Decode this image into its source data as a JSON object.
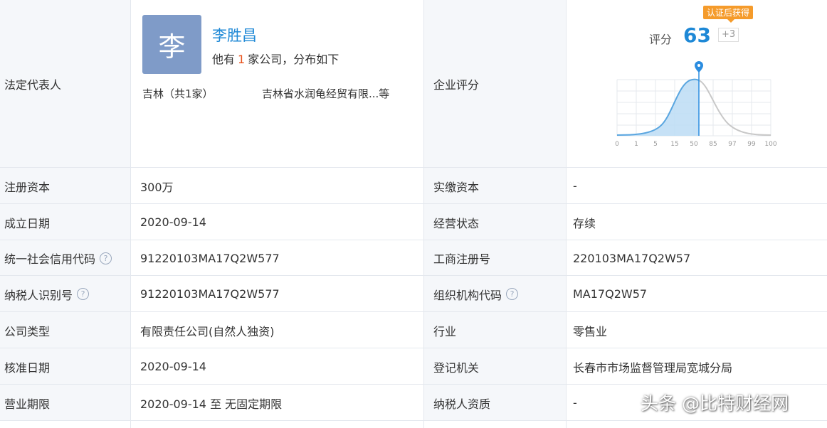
{
  "legal_rep": {
    "label": "法定代表人",
    "avatar_char": "李",
    "name": "李胜昌",
    "sub_prefix": "他有",
    "company_count": "1",
    "sub_suffix": "家公司，分布如下",
    "region": "吉林（共1家）",
    "company": "吉林省水润龟经贸有限...等"
  },
  "rating": {
    "label": "企业评分",
    "badge": "认证后获得",
    "score_label": "评分",
    "score": 63,
    "delta": "+3",
    "axis_ticks": [
      "0",
      "1",
      "5",
      "15",
      "50",
      "85",
      "97",
      "99",
      "100"
    ],
    "colors": {
      "accent": "#1e88d6",
      "curve_fill": "#bcdcf5",
      "marker": "#2b8de0",
      "badge": "#f59b2b",
      "count": "#e8541e"
    }
  },
  "rows": [
    {
      "left_label": "注册资本",
      "left_value": "300万",
      "right_label": "实缴资本",
      "right_value": "-"
    },
    {
      "left_label": "成立日期",
      "left_value": "2020-09-14",
      "right_label": "经营状态",
      "right_value": "存续"
    },
    {
      "left_label": "统一社会信用代码",
      "left_help": true,
      "left_value": "91220103MA17Q2W577",
      "right_label": "工商注册号",
      "right_value": "220103MA17Q2W57"
    },
    {
      "left_label": "纳税人识别号",
      "left_help": true,
      "left_value": "91220103MA17Q2W577",
      "right_label": "组织机构代码",
      "right_help": true,
      "right_value": "MA17Q2W57"
    },
    {
      "left_label": "公司类型",
      "left_value": "有限责任公司(自然人独资)",
      "right_label": "行业",
      "right_value": "零售业"
    },
    {
      "left_label": "核准日期",
      "left_value": "2020-09-14",
      "right_label": "登记机关",
      "right_value": "长春市市场监督管理局宽城分局"
    },
    {
      "left_label": "营业期限",
      "left_value": "2020-09-14 至 无固定期限",
      "right_label": "纳税人资质",
      "right_value": "-"
    }
  ],
  "help_icon_glyph": "?",
  "watermark": "头条 @比特财经网"
}
